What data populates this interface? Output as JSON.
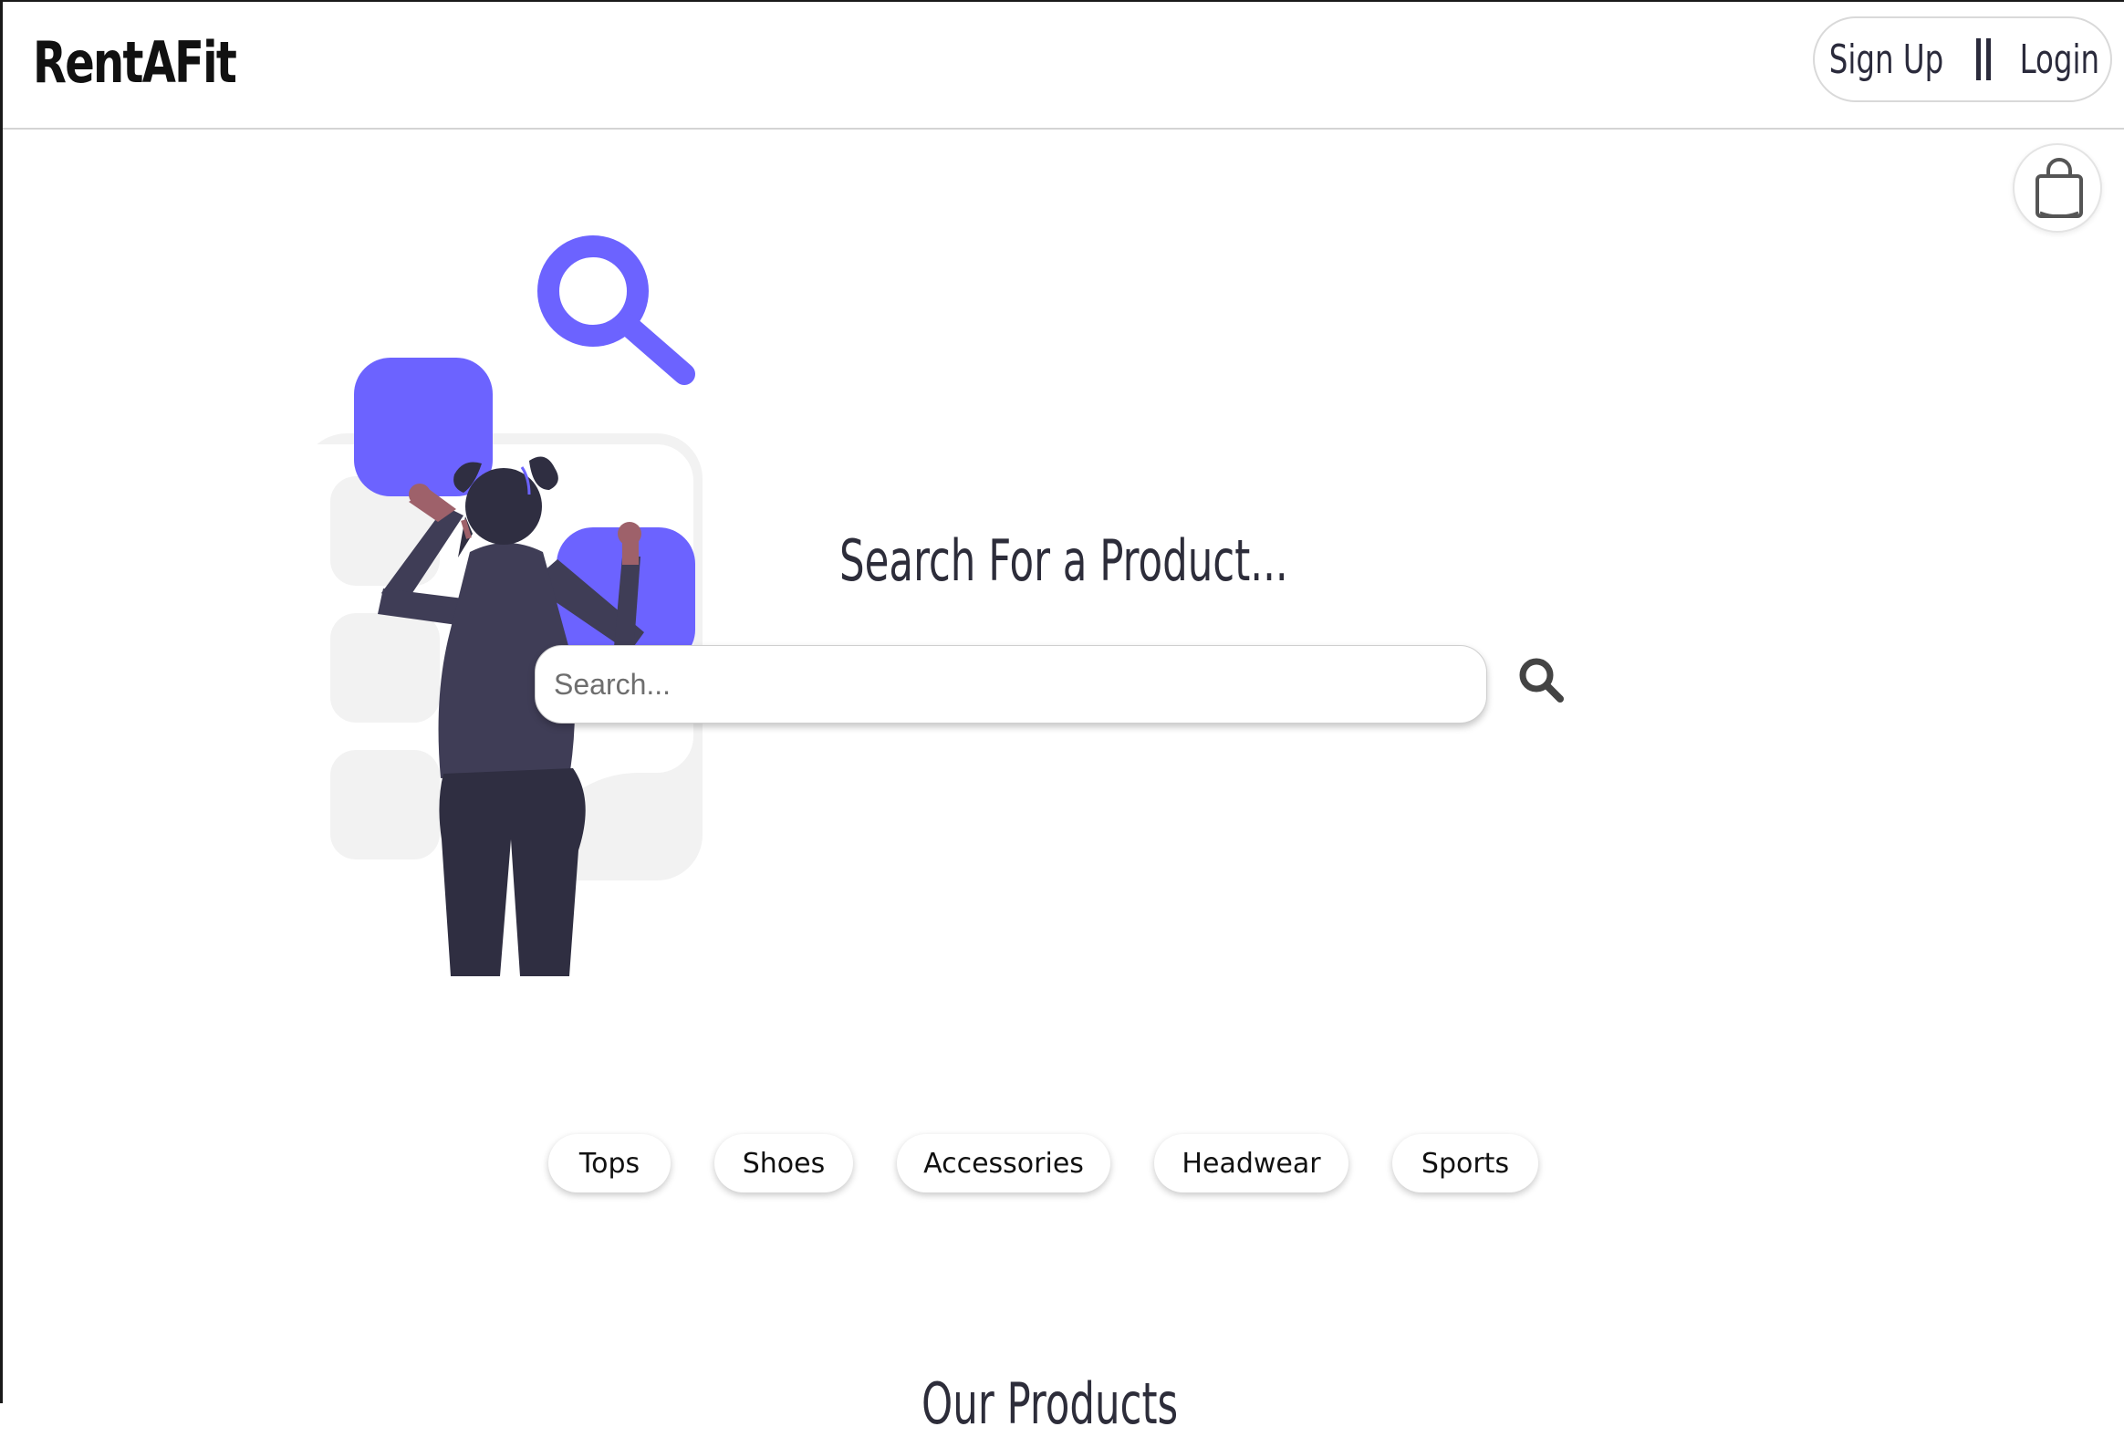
{
  "header": {
    "brand": "RentAFit",
    "signup_label": "Sign Up",
    "login_label": "Login"
  },
  "cart": {
    "icon": "shopping-bag-icon"
  },
  "hero": {
    "title": "Search For a Product...",
    "search_placeholder": "Search...",
    "search_icon": "search-icon",
    "illustration": "woman-arranging-tiles-illustration"
  },
  "categories": [
    {
      "label": "Tops"
    },
    {
      "label": "Shoes"
    },
    {
      "label": "Accessories"
    },
    {
      "label": "Headwear"
    },
    {
      "label": "Sports"
    }
  ],
  "products": {
    "title": "Our Products"
  },
  "colors": {
    "accent": "#6c63ff",
    "text_dark": "#2d2d3a",
    "tile_gray": "#f2f2f2"
  }
}
